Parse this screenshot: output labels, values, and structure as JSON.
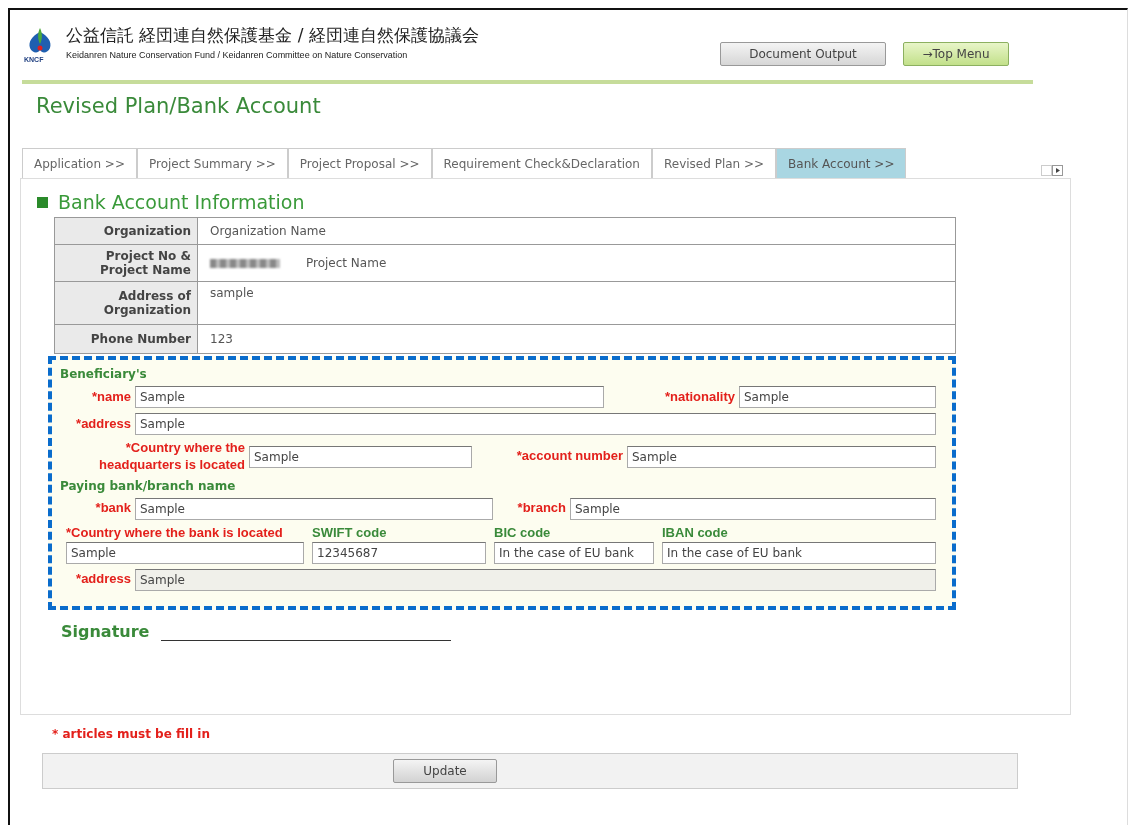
{
  "header": {
    "logo_text": "KNCF",
    "title": "公益信託 経団連自然保護基金 / 経団連自然保護協議会",
    "subtitle": "Keidanren Nature Conservation Fund / Keidanren Committee on Nature Conservation",
    "buttons": [
      {
        "label": "Document Output",
        "kind": "grey"
      },
      {
        "label": "→Top Menu",
        "kind": "green"
      }
    ]
  },
  "page_title": "Revised Plan/Bank Account",
  "tabs": [
    {
      "label": "Application >>",
      "selected": false
    },
    {
      "label": "Project Summary >>",
      "selected": false
    },
    {
      "label": "Project Proposal >>",
      "selected": false
    },
    {
      "label": "Requirement Check&Declaration",
      "selected": false
    },
    {
      "label": "Revised Plan >>",
      "selected": false
    },
    {
      "label": "Bank Account >>",
      "selected": true
    }
  ],
  "section_title": "Bank Account Information",
  "info_rows": [
    {
      "label": "Organization",
      "value": "Organization Name",
      "redacted": false
    },
    {
      "label": "Project No & Project Name",
      "value": "Project Name",
      "redacted": true
    },
    {
      "label": "Address of Organization",
      "value": "sample",
      "redacted": false
    },
    {
      "label": "Phone Number",
      "value": "123",
      "redacted": false
    }
  ],
  "groups": [
    {
      "heading": "Beneficiary's",
      "lines": [
        {
          "fields": [
            {
              "label": "*name",
              "value": "Sample",
              "required": true,
              "disabled": false
            },
            {
              "label": "*nationality",
              "value": "Sample",
              "required": true,
              "disabled": false
            }
          ]
        },
        {
          "fields": [
            {
              "label": "*address",
              "value": "Sample",
              "required": true,
              "disabled": false
            }
          ]
        },
        {
          "fields": [
            {
              "label": "*Country where the headquarters is located",
              "value": "Sample",
              "required": true,
              "disabled": false
            },
            {
              "label": "*account number",
              "value": "Sample",
              "required": true,
              "disabled": false
            }
          ]
        }
      ]
    },
    {
      "heading": "Paying bank/branch name",
      "lines": [
        {
          "fields": [
            {
              "label": "*bank",
              "value": "Sample",
              "required": true,
              "disabled": false
            },
            {
              "label": "*branch",
              "value": "Sample",
              "required": true,
              "disabled": false
            }
          ]
        },
        {
          "fields": [
            {
              "label": "*Country where the bank is located",
              "value": "Sample",
              "required": true,
              "disabled": false
            },
            {
              "label": "SWIFT code",
              "value": "12345687",
              "required": false,
              "disabled": false
            },
            {
              "label": "BIC code",
              "value": "In the case of EU bank",
              "required": false,
              "disabled": false
            },
            {
              "label": "IBAN code",
              "value": "In the case of EU bank",
              "required": false,
              "disabled": false
            }
          ]
        },
        {
          "fields": [
            {
              "label": "*address",
              "value": "Sample",
              "required": true,
              "disabled": true
            }
          ]
        }
      ]
    }
  ],
  "signature_label": "Signature",
  "required_note": "* articles must be fill in",
  "update_button": "Update"
}
